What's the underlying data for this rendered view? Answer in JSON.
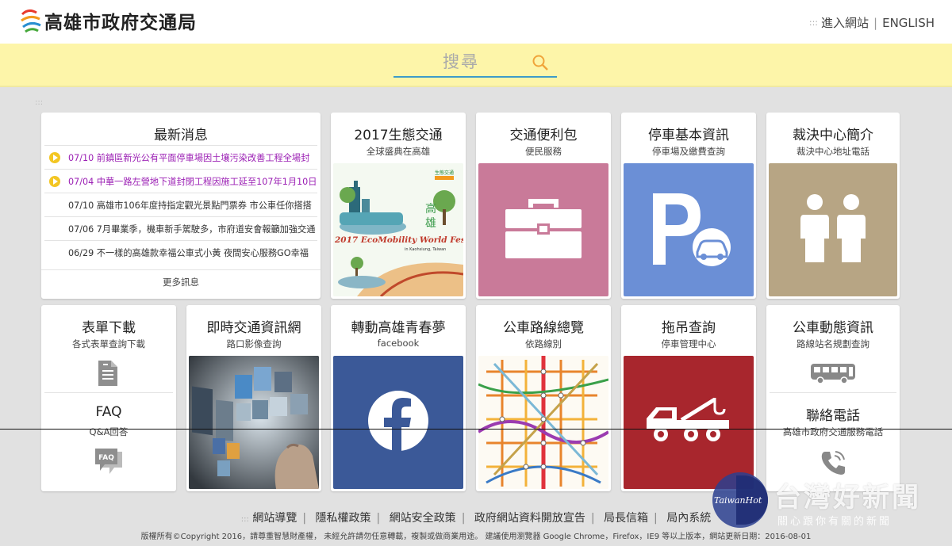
{
  "header": {
    "site_title": "高雄市政府交通局",
    "enter_site": "進入網站",
    "english": "ENGLISH",
    "dots": ":::"
  },
  "search": {
    "placeholder": "搜尋"
  },
  "grid_dots": ":::",
  "news": {
    "title": "最新消息",
    "items": [
      {
        "text": "07/10 前鎮區新光公有平面停車場因土壤污染改善工程全場封",
        "highlight": true
      },
      {
        "text": "07/04 中華一路左營地下道封閉工程因施工延至107年1月10日",
        "highlight": true
      },
      {
        "text": "07/10 高雄市106年度持指定觀光景點門票券 市公車任你搭搭",
        "highlight": false
      },
      {
        "text": "07/06 7月畢業季，機車新手駕駛多，市府道安會報籲加強交通",
        "highlight": false
      },
      {
        "text": "06/29 不一樣的高雄款幸福公車式小黃 夜間安心服務GO幸福",
        "highlight": false
      }
    ],
    "more": "更多訊息"
  },
  "cards": {
    "eco": {
      "title": "2017生態交通",
      "sub": "全球盛典在高雄",
      "poster_title": "2017 EcoMobility World Festival",
      "poster_sub": "in Kaohsiung, Taiwan"
    },
    "kit": {
      "title": "交通便利包",
      "sub": "便民服務"
    },
    "parking": {
      "title": "停車基本資訊",
      "sub": "停車場及繳費查詢"
    },
    "adjudication": {
      "title": "裁決中心簡介",
      "sub": "裁決中心地址電話"
    },
    "forms": {
      "title": "表單下載",
      "sub": "各式表單查詢下載"
    },
    "faq": {
      "title": "FAQ",
      "sub": "Q&A回答",
      "icon_text": "FAQ"
    },
    "realtime": {
      "title": "即時交通資訊網",
      "sub": "路口影像查詢"
    },
    "facebook": {
      "title": "轉動高雄青春夢",
      "sub": "facebook"
    },
    "busmap": {
      "title": "公車路線總覽",
      "sub": "依路線別"
    },
    "towing": {
      "title": "拖吊查詢",
      "sub": "停車管理中心"
    },
    "busdyn": {
      "title": "公車動態資訊",
      "sub": "路線站名規劃查詢"
    },
    "phone": {
      "title": "聯絡電話",
      "sub": "高雄市政府交通服務電話"
    }
  },
  "colors": {
    "kit_bg": "#c97a99",
    "parking_bg": "#6b8fd6",
    "adjudication_bg": "#b7a584",
    "facebook_bg": "#3b5998",
    "towing_bg": "#a8262d",
    "search_band": "#fdf5a9",
    "highlight_text": "#9b1fb4"
  },
  "footer": {
    "dots": ":::",
    "links": [
      "網站導覽",
      "隱私權政策",
      "網站安全政策",
      "政府網站資料開放宣告",
      "局長信箱",
      "局內系統"
    ],
    "copyright": "版權所有©Copyright 2016，請尊重智慧財產權， 未經允許請勿任意轉載，複製或做商業用途。 建議使用瀏覽器 Google Chrome，Firefox，IE9 等以上版本，網站更新日期：2016-08-01"
  },
  "watermark": {
    "logo": "TaiwanHot",
    "big": "台灣好新聞",
    "small": "關心跟你有關的新聞"
  }
}
